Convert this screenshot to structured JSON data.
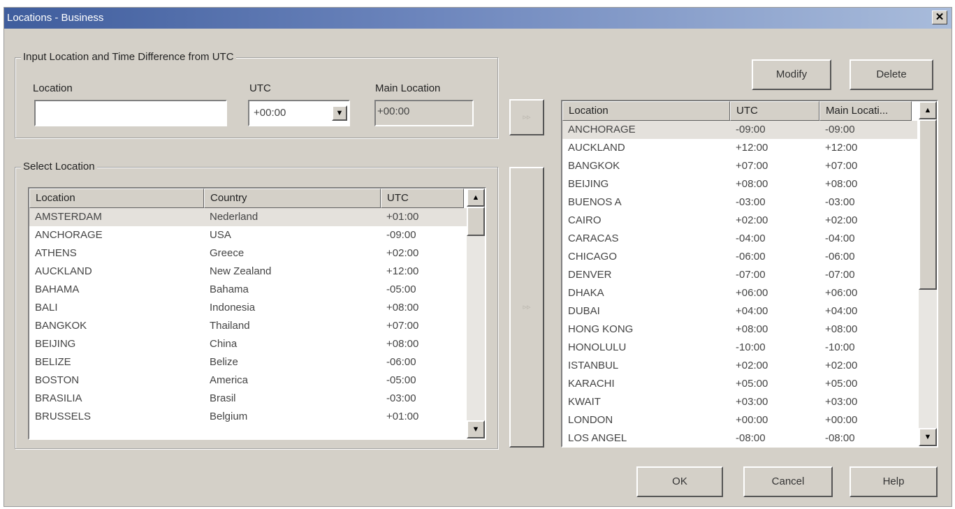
{
  "window": {
    "title": "Locations - Business",
    "close_label": "✕"
  },
  "input_group": {
    "legend": "Input Location and Time Difference from UTC",
    "location_label": "Location",
    "location_value": "",
    "utc_label": "UTC",
    "utc_value": "+00:00",
    "main_location_label": "Main Location",
    "main_location_value": "+00:00"
  },
  "select_group": {
    "legend": "Select Location",
    "columns": [
      "Location",
      "Country",
      "UTC"
    ],
    "rows": [
      {
        "location": "AMSTERDAM",
        "country": "Nederland",
        "utc": "+01:00"
      },
      {
        "location": "ANCHORAGE",
        "country": "USA",
        "utc": "-09:00"
      },
      {
        "location": "ATHENS",
        "country": "Greece",
        "utc": "+02:00"
      },
      {
        "location": "AUCKLAND",
        "country": "New Zealand",
        "utc": "+12:00"
      },
      {
        "location": "BAHAMA",
        "country": "Bahama",
        "utc": "-05:00"
      },
      {
        "location": "BALI",
        "country": "Indonesia",
        "utc": "+08:00"
      },
      {
        "location": "BANGKOK",
        "country": "Thailand",
        "utc": "+07:00"
      },
      {
        "location": "BEIJING",
        "country": "China",
        "utc": "+08:00"
      },
      {
        "location": "BELIZE",
        "country": "Belize",
        "utc": "-06:00"
      },
      {
        "location": "BOSTON",
        "country": "America",
        "utc": "-05:00"
      },
      {
        "location": "BRASILIA",
        "country": "Brasil",
        "utc": "-03:00"
      },
      {
        "location": "BRUSSELS",
        "country": "Belgium",
        "utc": "+01:00"
      }
    ]
  },
  "arrows": {
    "add_top": "▹▹",
    "add_main": "▹▹"
  },
  "right_list": {
    "modify_label": "Modify",
    "delete_label": "Delete",
    "columns": [
      "Location",
      "UTC",
      "Main Locati..."
    ],
    "rows": [
      {
        "location": "ANCHORAGE",
        "utc": "-09:00",
        "main": "-09:00"
      },
      {
        "location": "AUCKLAND",
        "utc": "+12:00",
        "main": "+12:00"
      },
      {
        "location": "BANGKOK",
        "utc": "+07:00",
        "main": "+07:00"
      },
      {
        "location": "BEIJING",
        "utc": "+08:00",
        "main": "+08:00"
      },
      {
        "location": "BUENOS A",
        "utc": "-03:00",
        "main": "-03:00"
      },
      {
        "location": "CAIRO",
        "utc": "+02:00",
        "main": "+02:00"
      },
      {
        "location": "CARACAS",
        "utc": "-04:00",
        "main": "-04:00"
      },
      {
        "location": "CHICAGO",
        "utc": "-06:00",
        "main": "-06:00"
      },
      {
        "location": "DENVER",
        "utc": "-07:00",
        "main": "-07:00"
      },
      {
        "location": "DHAKA",
        "utc": "+06:00",
        "main": "+06:00"
      },
      {
        "location": "DUBAI",
        "utc": "+04:00",
        "main": "+04:00"
      },
      {
        "location": "HONG KONG",
        "utc": "+08:00",
        "main": "+08:00"
      },
      {
        "location": "HONOLULU",
        "utc": "-10:00",
        "main": "-10:00"
      },
      {
        "location": "ISTANBUL",
        "utc": "+02:00",
        "main": "+02:00"
      },
      {
        "location": "KARACHI",
        "utc": "+05:00",
        "main": "+05:00"
      },
      {
        "location": "KWAIT",
        "utc": "+03:00",
        "main": "+03:00"
      },
      {
        "location": "LONDON",
        "utc": "+00:00",
        "main": "+00:00"
      },
      {
        "location": "LOS ANGEL",
        "utc": "-08:00",
        "main": "-08:00"
      }
    ]
  },
  "footer": {
    "ok_label": "OK",
    "cancel_label": "Cancel",
    "help_label": "Help"
  },
  "icons": {
    "close": "close-icon",
    "dropdown": "chevron-down-icon",
    "scroll_up": "arrow-up-icon",
    "scroll_down": "arrow-down-icon"
  }
}
